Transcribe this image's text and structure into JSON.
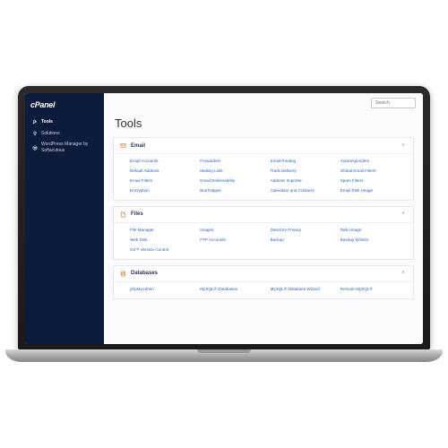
{
  "brand": "cPanel",
  "sidebar": {
    "items": [
      {
        "label": "Tools",
        "icon": "wrench"
      },
      {
        "label": "Solutions",
        "icon": "bulb"
      },
      {
        "label": "WordPress Manager by Softaculous",
        "icon": "wordpress"
      }
    ]
  },
  "search": {
    "placeholder": "Search"
  },
  "page": {
    "title": "Tools"
  },
  "sections": [
    {
      "title": "Email",
      "items": [
        "Email Accounts",
        "Forwarders",
        "Email Routing",
        "Autoresponders",
        "Default Address",
        "Mailing Lists",
        "Track Delivery",
        "Global Email Filters",
        "Email Filters",
        "Email Deliverability",
        "Address Importer",
        "Spam Filters",
        "Encryption",
        "BoxTrapper",
        "Calendars and Contacts",
        "Email Disk Usage"
      ]
    },
    {
      "title": "Files",
      "items": [
        "File Manager",
        "Images",
        "Directory Privacy",
        "Disk Usage",
        "Web Disk",
        "FTP Accounts",
        "Backup",
        "Backup Wizard",
        "Git™ Version Control"
      ]
    },
    {
      "title": "Databases",
      "items": [
        "phpMyAdmin",
        "MySQL® Databases",
        "MySQL® Database Wizard",
        "Remote MySQL®"
      ]
    }
  ]
}
